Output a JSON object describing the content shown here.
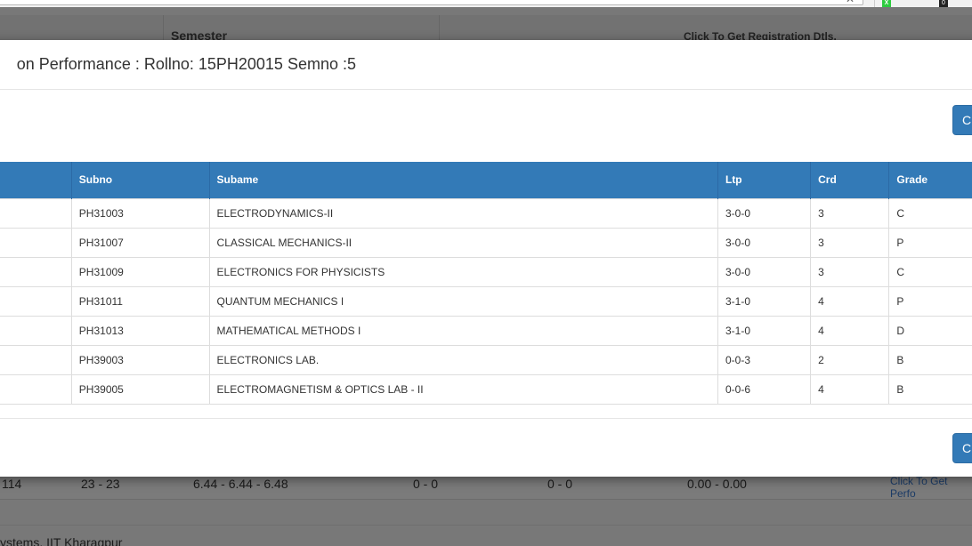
{
  "background": {
    "header": {
      "semester_label": "Semester",
      "registration_label": "Click To Get Registration Dtls."
    },
    "row": {
      "col1": "114",
      "col2": "23 - 23",
      "col3": "6.44 - 6.44 - 6.48",
      "col4": "0 - 0",
      "col5": "0 - 0",
      "col6": "0.00 - 0.00",
      "link": "Click To Get Perfo"
    },
    "footer_text": "ystems, IIT Kharagpur"
  },
  "modal": {
    "title": "on Performance : Rollno: 15PH20015 Semno :5",
    "close_button_top": "C",
    "close_button_bottom": "C",
    "table": {
      "headers": [
        "",
        "Subno",
        "Subame",
        "Ltp",
        "Crd",
        "Grade"
      ],
      "rows": [
        [
          "",
          "PH31003",
          "ELECTRODYNAMICS-II",
          "3-0-0",
          "3",
          "C"
        ],
        [
          "",
          "PH31007",
          "CLASSICAL MECHANICS-II",
          "3-0-0",
          "3",
          "P"
        ],
        [
          "",
          "PH31009",
          "ELECTRONICS FOR PHYSICISTS",
          "3-0-0",
          "3",
          "C"
        ],
        [
          "",
          "PH31011",
          "QUANTUM MECHANICS I",
          "3-1-0",
          "4",
          "P"
        ],
        [
          "",
          "PH31013",
          "MATHEMATICAL METHODS I",
          "3-1-0",
          "4",
          "D"
        ],
        [
          "",
          "PH39003",
          "ELECTRONICS LAB.",
          "0-0-3",
          "2",
          "B"
        ],
        [
          "",
          "PH39005",
          "ELECTROMAGNETISM & OPTICS LAB - II",
          "0-0-6",
          "4",
          "B"
        ]
      ]
    }
  },
  "browser": {
    "extension_green_label": "X",
    "extension_black_label": "0"
  },
  "colors": {
    "primary": "#337ab7",
    "overlay_bg": "#787878"
  }
}
